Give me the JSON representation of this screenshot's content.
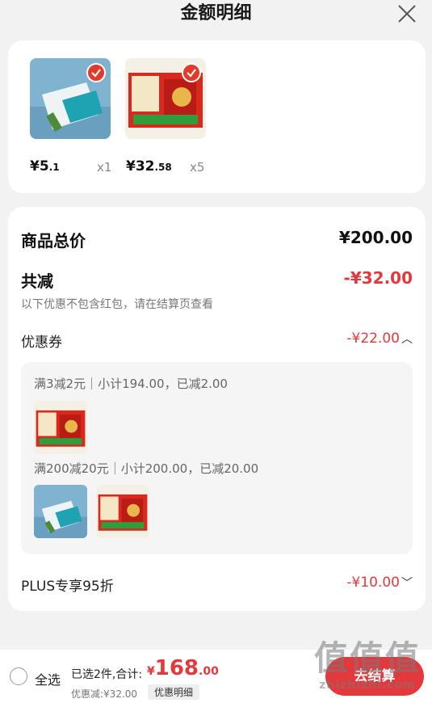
{
  "header": {
    "title": "金额明细"
  },
  "products": [
    {
      "price_main": "¥5",
      "price_dec": ".1",
      "qty": "x1",
      "thumb": "blue-pack"
    },
    {
      "price_main": "¥32",
      "price_dec": ".58",
      "qty": "x5",
      "thumb": "red-giftbox"
    }
  ],
  "summary": {
    "total_label": "商品总价",
    "total_value": "¥200.00",
    "reduce_label": "共减",
    "reduce_value": "-¥32.00",
    "note": "以下优惠不包含红包，请在结算页查看"
  },
  "coupon": {
    "label": "优惠券",
    "value": "-¥22.00",
    "rules": [
      {
        "text": "满3减2元｜小计194.00，已减2.00"
      },
      {
        "text": "满200减20元｜小计200.00，已减20.00"
      }
    ]
  },
  "plus": {
    "label": "PLUS专享95折",
    "value": "-¥10.00"
  },
  "bottom": {
    "select_all": "全选",
    "selected": "已选2件,合计:",
    "total_yen": "¥",
    "total_int": "168",
    "total_dec": ".00",
    "discount": "优惠减:¥32.00",
    "detail_btn": "优惠明细",
    "checkout": "去结算"
  },
  "watermark": {
    "logo": "值值值",
    "url": "zhizhizhi.com"
  },
  "colors": {
    "accent": "#e4393c",
    "background": "#f2f2f2"
  }
}
